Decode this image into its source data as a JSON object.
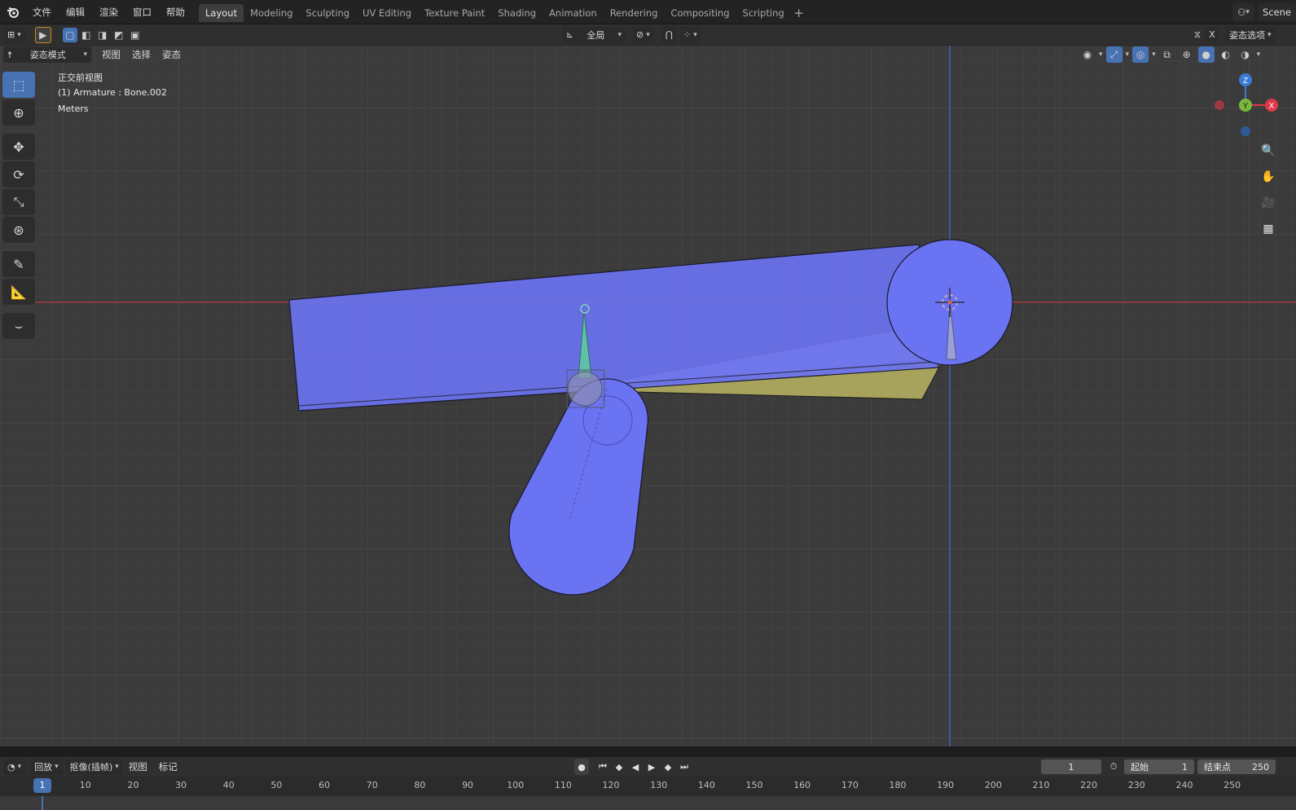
{
  "topbar": {
    "menu": [
      "文件",
      "编辑",
      "渲染",
      "窗口",
      "帮助"
    ],
    "workspaces": [
      "Layout",
      "Modeling",
      "Sculpting",
      "UV Editing",
      "Texture Paint",
      "Shading",
      "Animation",
      "Rendering",
      "Compositing",
      "Scripting"
    ],
    "active_workspace": "Layout",
    "add_workspace": "+",
    "scene": "Scene"
  },
  "header1": {
    "transform_orientation": "全局",
    "pose_options": "姿态选项",
    "x_mirror": "X"
  },
  "header2": {
    "mode": "姿态模式",
    "menus": [
      "视图",
      "选择",
      "姿态"
    ]
  },
  "viewport": {
    "view_name": "正交前视图",
    "object_info": "(1) Armature : Bone.002",
    "units": "Meters"
  },
  "gizmo": {
    "z": "Z",
    "y": "Y",
    "x": "X"
  },
  "timeline": {
    "menus": [
      "回放",
      "抠像(插帧)",
      "视图",
      "标记"
    ],
    "current_frame": "1",
    "start_label": "起始",
    "start_value": "1",
    "end_label": "结束点",
    "end_value": "250",
    "ticks": [
      "10",
      "20",
      "30",
      "40",
      "50",
      "60",
      "70",
      "80",
      "90",
      "100",
      "110",
      "120",
      "130",
      "140",
      "150",
      "160",
      "170",
      "180",
      "190",
      "200",
      "210",
      "220",
      "230",
      "240",
      "250"
    ],
    "playhead": "1"
  },
  "colors": {
    "bone_blue": "#6a73f2",
    "accent": "#4772b3",
    "axis_red": "#c0383f",
    "axis_blue": "#3a72c8",
    "mesh_yellow": "#a9a55a"
  }
}
